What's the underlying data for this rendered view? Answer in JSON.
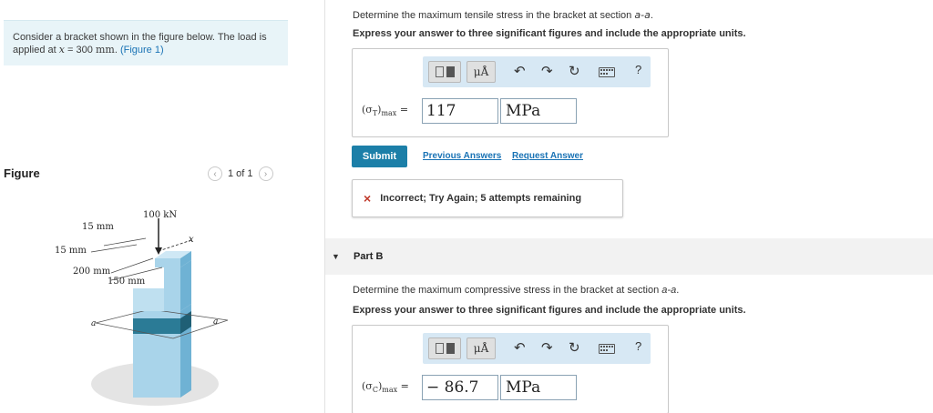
{
  "problem": {
    "text_before": "Consider a bracket shown in the figure below. The load is applied at ",
    "var": "x",
    "equals": " = 300 ",
    "unit": "mm",
    "text_after": ". ",
    "figure_link": "(Figure 1)"
  },
  "figure": {
    "label": "Figure",
    "pager_text": "1 of 1",
    "prev_icon": "chevron-left-icon",
    "next_icon": "chevron-right-icon",
    "annotations": {
      "load": "100 kN",
      "dim1": "15 mm",
      "dim2": "15 mm",
      "dim3": "200 mm",
      "dim4": "150 mm",
      "x_axis": "x",
      "section_left": "a",
      "section_right": "a"
    },
    "colors": {
      "block_face": "#a9d4ea",
      "block_side": "#6fb2d4",
      "section_band": "#2b7b96"
    }
  },
  "part_a": {
    "prompt_before": "Determine the maximum tensile stress in the bracket at section ",
    "section": "a-a",
    "prompt_after": ".",
    "instruction": "Express your answer to three significant figures and include the appropriate units.",
    "toolbar": {
      "mu_label": "μÅ",
      "undo_icon": "undo-icon",
      "redo_icon": "redo-icon",
      "reset_icon": "reset-icon",
      "keyboard_icon": "keyboard-icon",
      "help_label": "?"
    },
    "answer_label_sym": "(σ",
    "answer_label_sub_inner": "T",
    "answer_label_close": ")",
    "answer_label_sub": "max",
    "answer_label_eq": " =",
    "value": "117",
    "unit": "MPa",
    "submit_label": "Submit",
    "previous_answers": "Previous Answers",
    "request_answer": "Request Answer",
    "feedback_icon": "×",
    "feedback_text": "Incorrect; Try Again; 5 attempts remaining"
  },
  "part_b": {
    "title": "Part B",
    "prompt_before": "Determine the maximum compressive stress in the bracket at section ",
    "section": "a-a",
    "prompt_after": ".",
    "instruction": "Express your answer to three significant figures and include the appropriate units.",
    "toolbar": {
      "mu_label": "μÅ",
      "undo_icon": "undo-icon",
      "redo_icon": "redo-icon",
      "reset_icon": "reset-icon",
      "keyboard_icon": "keyboard-icon",
      "help_label": "?"
    },
    "answer_label_sym": "(σ",
    "answer_label_sub_inner": "C",
    "answer_label_close": ")",
    "answer_label_sub": "max",
    "answer_label_eq": " =",
    "value": "− 86.7",
    "unit": "MPa"
  },
  "colors": {
    "accent": "#1c7fa8",
    "link": "#1a73b5",
    "problem_bg": "#e8f4f8",
    "toolbar_bg": "#d7e8f4",
    "error": "#c0392b"
  }
}
